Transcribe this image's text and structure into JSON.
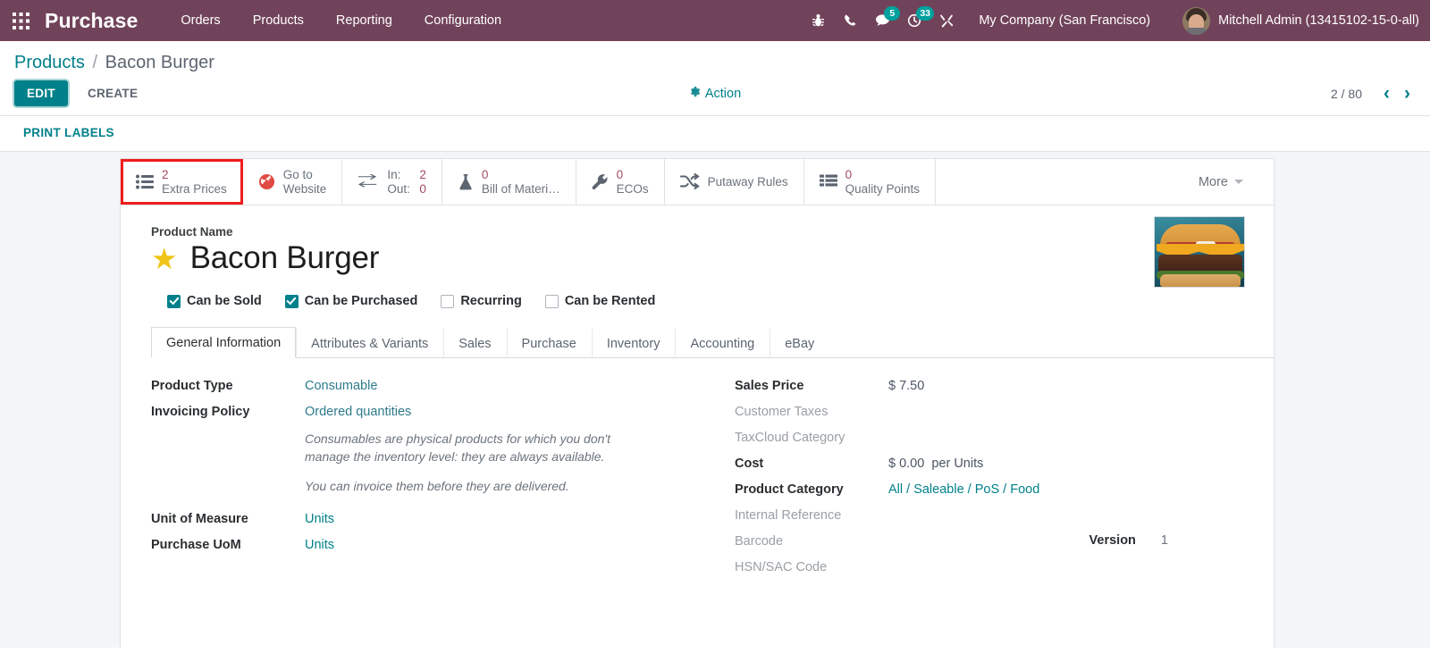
{
  "navbar": {
    "apps_icon": "grid-apps-icon",
    "brand": "Purchase",
    "menu": [
      {
        "label": "Orders"
      },
      {
        "label": "Products"
      },
      {
        "label": "Reporting"
      },
      {
        "label": "Configuration"
      }
    ],
    "sys_icons": [
      {
        "name": "bug-icon",
        "badge": ""
      },
      {
        "name": "phone-icon",
        "badge": ""
      },
      {
        "name": "messages-icon",
        "badge": "5"
      },
      {
        "name": "activities-clock-icon",
        "badge": "33"
      },
      {
        "name": "tools-icon",
        "badge": ""
      }
    ],
    "company": "My Company (San Francisco)",
    "user": "Mitchell Admin (13415102-15-0-all)",
    "accent_badge_color": "#00a09d",
    "bar_color": "#71435a"
  },
  "control_panel": {
    "breadcrumb_root": "Products",
    "breadcrumb_sep": "/",
    "breadcrumb_current": "Bacon Burger",
    "edit_label": "EDIT",
    "create_label": "CREATE",
    "action_label": "Action",
    "action_icon": "gear-icon",
    "pager_value": "2 / 80",
    "pager_prev_icon": "chevron-left-icon",
    "pager_next_icon": "chevron-right-icon",
    "print_labels_label": "PRINT LABELS"
  },
  "smart_buttons": [
    {
      "icon": "list-bullets-icon",
      "value": "2",
      "label": "Extra Prices",
      "highlighted": true,
      "type": "value"
    },
    {
      "icon": "globe-icon",
      "line1": "Go to",
      "line2": "Website",
      "highlighted": false,
      "type": "twoline"
    },
    {
      "icon": "in-out-arrows-icon",
      "in_key": "In:",
      "in_value": "2",
      "out_key": "Out:",
      "out_value": "0",
      "highlighted": false,
      "type": "inout"
    },
    {
      "icon": "flask-icon",
      "value": "0",
      "label": "Bill of Materi…",
      "highlighted": false,
      "type": "value"
    },
    {
      "icon": "wrench-icon",
      "value": "0",
      "label": "ECOs",
      "highlighted": false,
      "type": "value"
    },
    {
      "icon": "shuffle-icon",
      "label": "Putaway Rules",
      "highlighted": false,
      "type": "label"
    },
    {
      "icon": "list-icon",
      "value": "0",
      "label": "Quality Points",
      "highlighted": false,
      "type": "value"
    }
  ],
  "more_button": {
    "label": "More",
    "icon": "caret-down-icon"
  },
  "product": {
    "name_label": "Product Name",
    "name": "Bacon Burger",
    "favorite_icon": "star-icon",
    "image_alt": "bacon-burger-photo",
    "checkboxes": [
      {
        "label": "Can be Sold",
        "checked": true
      },
      {
        "label": "Can be Purchased",
        "checked": true
      },
      {
        "label": "Recurring",
        "checked": false
      },
      {
        "label": "Can be Rented",
        "checked": false
      }
    ]
  },
  "tabs": [
    {
      "label": "General Information",
      "active": true
    },
    {
      "label": "Attributes & Variants",
      "active": false
    },
    {
      "label": "Sales",
      "active": false
    },
    {
      "label": "Purchase",
      "active": false
    },
    {
      "label": "Inventory",
      "active": false
    },
    {
      "label": "Accounting",
      "active": false
    },
    {
      "label": "eBay",
      "active": false
    }
  ],
  "form": {
    "left": {
      "product_type_label": "Product Type",
      "product_type_value": "Consumable",
      "invoicing_policy_label": "Invoicing Policy",
      "invoicing_policy_value": "Ordered quantities",
      "help_1": "Consumables are physical products for which you don't manage the inventory level: they are always available.",
      "help_2": "You can invoice them before they are delivered.",
      "uom_label": "Unit of Measure",
      "uom_value": "Units",
      "purchase_uom_label": "Purchase UoM",
      "purchase_uom_value": "Units"
    },
    "right": {
      "sales_price_label": "Sales Price",
      "sales_price_value": "$ 7.50",
      "customer_taxes_label": "Customer Taxes",
      "customer_taxes_value": "",
      "taxcloud_label": "TaxCloud Category",
      "taxcloud_value": "",
      "cost_label": "Cost",
      "cost_value": "$ 0.00",
      "cost_suffix": "per Units",
      "product_category_label": "Product Category",
      "product_category_value": "All / Saleable / PoS / Food",
      "internal_reference_label": "Internal Reference",
      "internal_reference_value": "",
      "barcode_label": "Barcode",
      "barcode_value": "",
      "hsn_label": "HSN/SAC Code",
      "hsn_value": "",
      "version_label": "Version",
      "version_value": "1"
    }
  },
  "colors": {
    "primary_teal": "#00808a",
    "navbar_purple": "#71435a",
    "highlight_red": "#f01c1c",
    "smart_value": "#a24b5e"
  }
}
